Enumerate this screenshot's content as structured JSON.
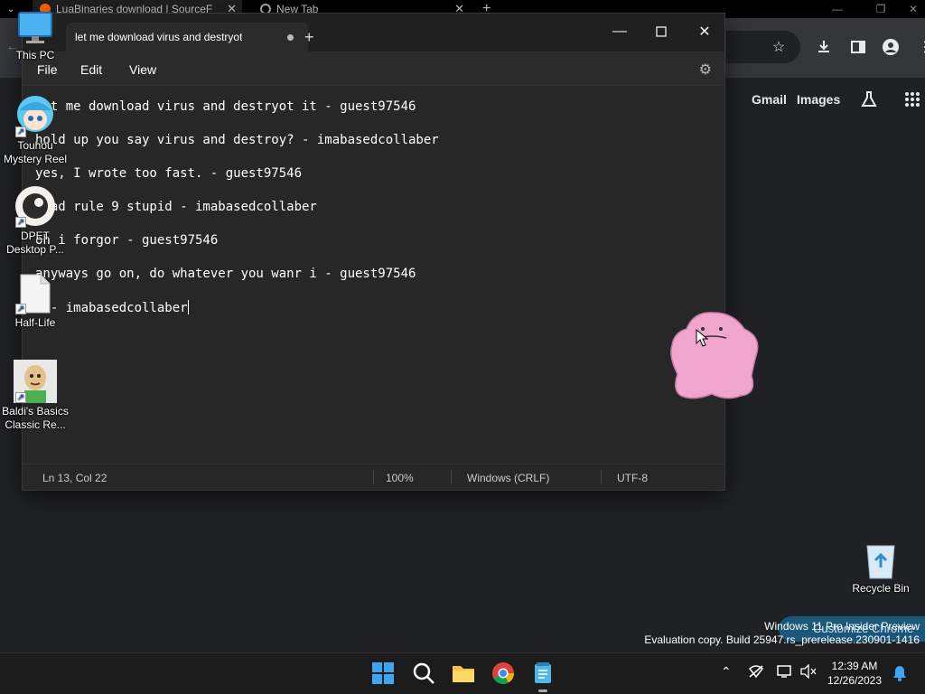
{
  "browser": {
    "tabs": [
      {
        "title": "LuaBinaries download | SourceF"
      },
      {
        "title": "New Tab"
      }
    ],
    "links": [
      "Gmail",
      "Images"
    ],
    "customize_label": "Customize Chrome"
  },
  "desktop": {
    "icons": [
      {
        "label": "This PC"
      },
      {
        "label": "Touhou Mystery Reel"
      },
      {
        "label": "DPET Desktop P..."
      },
      {
        "label": "Half-Life"
      },
      {
        "label": "Baldi's Basics Classic Re..."
      },
      {
        "label": "Recycle Bin"
      }
    ],
    "watermark": {
      "line1": "Windows 11 Pro Insider Preview",
      "line2": "Evaluation copy. Build 25947.rs_prerelease.230901-1416"
    }
  },
  "notepad": {
    "tab_title": "let me download virus and destryot",
    "menu": [
      "File",
      "Edit",
      "View"
    ],
    "lines": [
      "let me download virus and destryot it - guest97546",
      "hold up you say virus and destroy? - imabasedcollaber",
      "yes, I wrote too fast. - guest97546",
      "read rule 9 stupid - imabasedcollaber",
      "oh i forgor - guest97546",
      "anyways go on, do whatever you wanr i - guest97546",
      "k - imabasedcollaber"
    ],
    "status": {
      "position": "Ln 13, Col 22",
      "zoom": "100%",
      "line_ending": "Windows (CRLF)",
      "encoding": "UTF-8"
    }
  },
  "taskbar": {
    "clock_time": "12:39 AM",
    "clock_date": "12/26/2023"
  }
}
